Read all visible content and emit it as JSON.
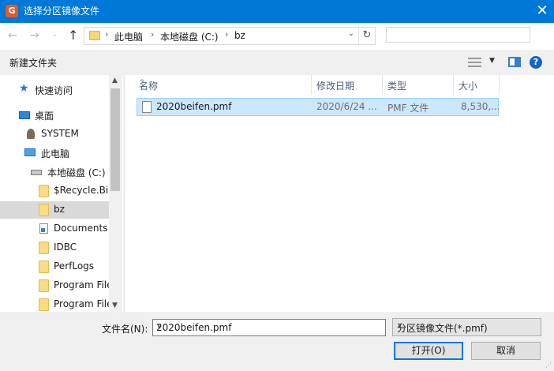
{
  "window": {
    "title": "选择分区镜像文件",
    "close_glyph": "✕",
    "app_icon_glyph": "G"
  },
  "nav": {
    "back_glyph": "←",
    "forward_glyph": "→",
    "recent_glyph": "⌄",
    "up_glyph": "↑",
    "breadcrumb": [
      "此电脑",
      "本地磁盘 (C:)",
      "bz"
    ],
    "separator": "›",
    "dropdown_glyph": "⌄",
    "refresh_glyph": "↻",
    "search_placeholder": ""
  },
  "toolbar": {
    "new_folder": "新建文件夹",
    "help_glyph": "?",
    "dropdown_glyph": "▼"
  },
  "sidebar": {
    "items": [
      {
        "label": "快速访问",
        "icon": "star-icon"
      },
      {
        "label": "桌面",
        "icon": "desktop-icon"
      },
      {
        "label": "SYSTEM",
        "icon": "user-icon"
      },
      {
        "label": "此电脑",
        "icon": "computer-icon"
      },
      {
        "label": "本地磁盘 (C:)",
        "icon": "drive-icon"
      },
      {
        "label": "$Recycle.Bin",
        "icon": "folder-icon"
      },
      {
        "label": "bz",
        "icon": "folder-icon",
        "selected": true
      },
      {
        "label": "Documents",
        "icon": "shortcut-icon"
      },
      {
        "label": "IDBC",
        "icon": "folder-icon"
      },
      {
        "label": "PerfLogs",
        "icon": "folder-icon"
      },
      {
        "label": "Program File",
        "icon": "folder-icon"
      },
      {
        "label": "Program File",
        "icon": "folder-icon"
      }
    ],
    "scroll_up": "▲",
    "scroll_down": "▼"
  },
  "filelist": {
    "columns": [
      "名称",
      "修改日期",
      "类型",
      "大小"
    ],
    "sort_glyph": "^",
    "files": [
      {
        "name": "2020beifen.pmf",
        "date": "2020/6/24 ...",
        "type": "PMF 文件",
        "size": "8,530,..."
      }
    ]
  },
  "footer": {
    "filename_label": "文件名(N):",
    "filename_value": "2020beifen.pmf",
    "filter_value": "分区镜像文件(*.pmf)",
    "dropdown_glyph": "∨",
    "open_button": "打开(O)",
    "cancel_button": "取消",
    "grip_glyph": "⋰"
  }
}
